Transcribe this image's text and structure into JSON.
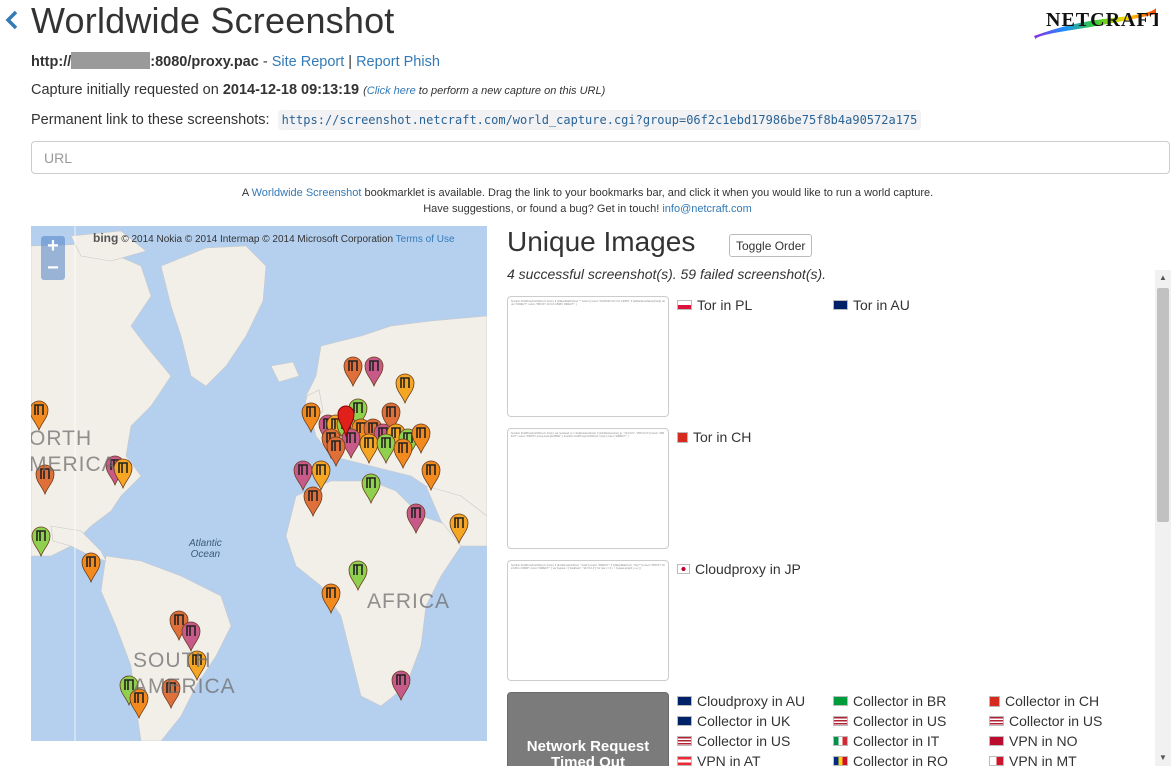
{
  "header": {
    "title": "Worldwide Screenshot",
    "logo_text": "NETCRAFT"
  },
  "url_line": {
    "prefix": "http://",
    "suffix": ":8080/proxy.pac",
    "separator1": " - ",
    "site_report": "Site Report",
    "separator2": " | ",
    "report_phish": "Report Phish"
  },
  "capture": {
    "label": "Capture initially requested on ",
    "date": "2014-12-18 09:13:19",
    "click_here": "Click here",
    "note": " to perform a new capture on this URL)",
    "open_paren": "("
  },
  "permalink": {
    "label": "Permanent link to these screenshots:",
    "url": "https://screenshot.netcraft.com/world_capture.cgi?group=06f2c1ebd17986be75f8b4a90572a175"
  },
  "url_input": {
    "placeholder": "URL"
  },
  "notice": {
    "a": "A ",
    "link": "Worldwide Screenshot",
    "b": " bookmarklet is available. Drag the link to your bookmarks bar, and click it when you would like to run a world capture.",
    "c": "Have suggestions, or found a bug? Get in touch! ",
    "email": "info@netcraft.com"
  },
  "map": {
    "zoom_in": "+",
    "zoom_out": "−",
    "bing": "bing",
    "attribution": "© 2014 Nokia © 2014 Intermap © 2014 Microsoft Corporation",
    "terms": "Terms of Use",
    "labels": {
      "north_america": "ORTH\nMERICA",
      "africa": "AFRICA",
      "south_america": "SOUTH\nAMERICA",
      "atlantic": "Atlantic\nOcean"
    }
  },
  "unique_images": {
    "title": "Unique Images",
    "toggle": "Toggle Order",
    "stats": "4 successful screenshot(s). 59 failed screenshot(s).",
    "groups": [
      {
        "locations": [
          "Tor in PL",
          "Tor in AU"
        ]
      },
      {
        "locations": [
          "Tor in CH"
        ]
      },
      {
        "locations": [
          "Cloudproxy in JP"
        ]
      }
    ],
    "failed_label": "Network Request Timed Out",
    "failed_locations": [
      "Cloudproxy in AU",
      "Collector in BR",
      "Collector in CH",
      "Collector in UK",
      "Collector in US",
      "Collector in US",
      "Collector in US",
      "Collector in IT",
      "VPN in NO",
      "VPN in AT",
      "Collector in RO",
      "VPN in MT"
    ]
  },
  "colors": {
    "link": "#337ab7",
    "ocean": "#b5d0ef",
    "land": "#f2efe9"
  }
}
